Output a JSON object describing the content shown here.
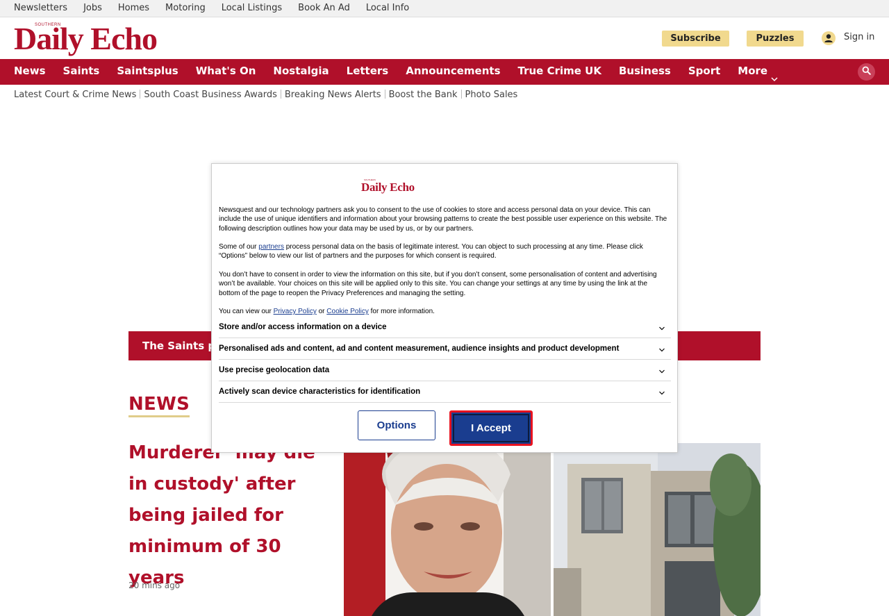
{
  "utility_nav": {
    "items": [
      "Newsletters",
      "Jobs",
      "Homes",
      "Motoring",
      "Local Listings",
      "Book An Ad",
      "Local Info"
    ]
  },
  "masthead": {
    "logo_small": "SOUTHERN",
    "logo_text": "Daily Echo",
    "subscribe_label": "Subscribe",
    "puzzles_label": "Puzzles",
    "signin_label": "Sign in"
  },
  "main_nav": {
    "items": [
      "News",
      "Saints",
      "Saintsplus",
      "What's On",
      "Nostalgia",
      "Letters",
      "Announcements",
      "True Crime UK",
      "Business",
      "Sport"
    ],
    "more_label": "More"
  },
  "sub_nav": {
    "items": [
      "Latest Court & Crime News",
      "South Coast Business Awards",
      "Breaking News Alerts",
      "Boost the Bank",
      "Photo Sales"
    ]
  },
  "banner": {
    "text": "The Saints pl"
  },
  "section": {
    "label": "NEWS"
  },
  "article": {
    "headline": "Murderer 'may die in custody' after being jailed for minimum of 30 years",
    "timestamp": "20 mins ago"
  },
  "consent": {
    "logo_small": "SOUTHERN",
    "logo_text": "Daily Echo",
    "p1": "Newsquest and our technology partners ask you to consent to the use of cookies to store and access personal data on your device. This can include the use of unique identifiers and information about your browsing patterns to create the best possible user experience on this website. The following description outlines how your data may be used by us, or by our partners.",
    "p2_before": "Some of our ",
    "p2_link": "partners",
    "p2_after": " process personal data on the basis of legitimate interest. You can object to such processing at any time. Please click “Options” below to view our list of partners and the purposes for which consent is required.",
    "p3": "You don’t have to consent in order to view the information on this site, but if you don’t consent, some personalisation of content and advertising won’t be available. Your choices on this site will be applied only to this site. You can change your settings at any time by using the link at the bottom of the page to reopen the Privacy Preferences and managing the setting.",
    "p4_before": "You can view our ",
    "p4_link1": "Privacy Policy",
    "p4_mid": " or ",
    "p4_link2": "Cookie Policy",
    "p4_after": " for more information.",
    "purposes": [
      "Store and/or access information on a device",
      "Personalised ads and content, ad and content measurement, audience insights and product development",
      "Use precise geolocation data",
      "Actively scan device characteristics for identification"
    ],
    "options_label": "Options",
    "accept_label": "I Accept"
  },
  "colors": {
    "brand_red": "#b0102a",
    "gold": "#f1d98e",
    "consent_blue": "#1a3d8f",
    "focus_red": "#e8121f"
  }
}
